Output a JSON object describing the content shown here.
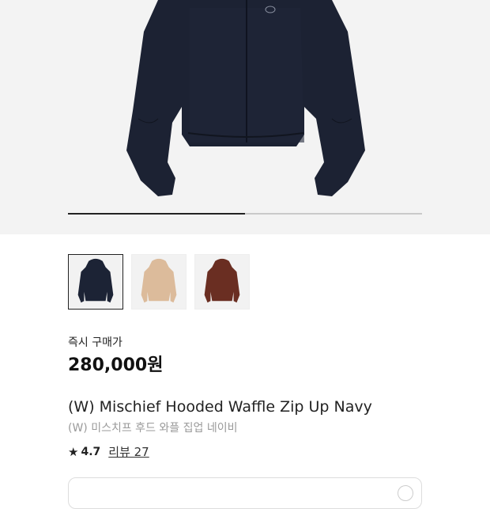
{
  "gallery": {
    "progress_fraction": 0.5,
    "thumbnails": [
      {
        "color_name": "navy",
        "color": "#1c2335",
        "selected": true
      },
      {
        "color_name": "beige",
        "color": "#dcbb9b",
        "selected": false
      },
      {
        "color_name": "brown",
        "color": "#6a2e22",
        "selected": false
      }
    ]
  },
  "pricing": {
    "label": "즉시 구매가",
    "price": "280,000원"
  },
  "product": {
    "name_en": "(W) Mischief Hooded Waffle Zip Up Navy",
    "name_ko": "(W) 미스치프 후드 와플 집업 네이비"
  },
  "rating": {
    "star_icon": "★",
    "value": "4.7",
    "reviews_label": "리뷰 27"
  }
}
